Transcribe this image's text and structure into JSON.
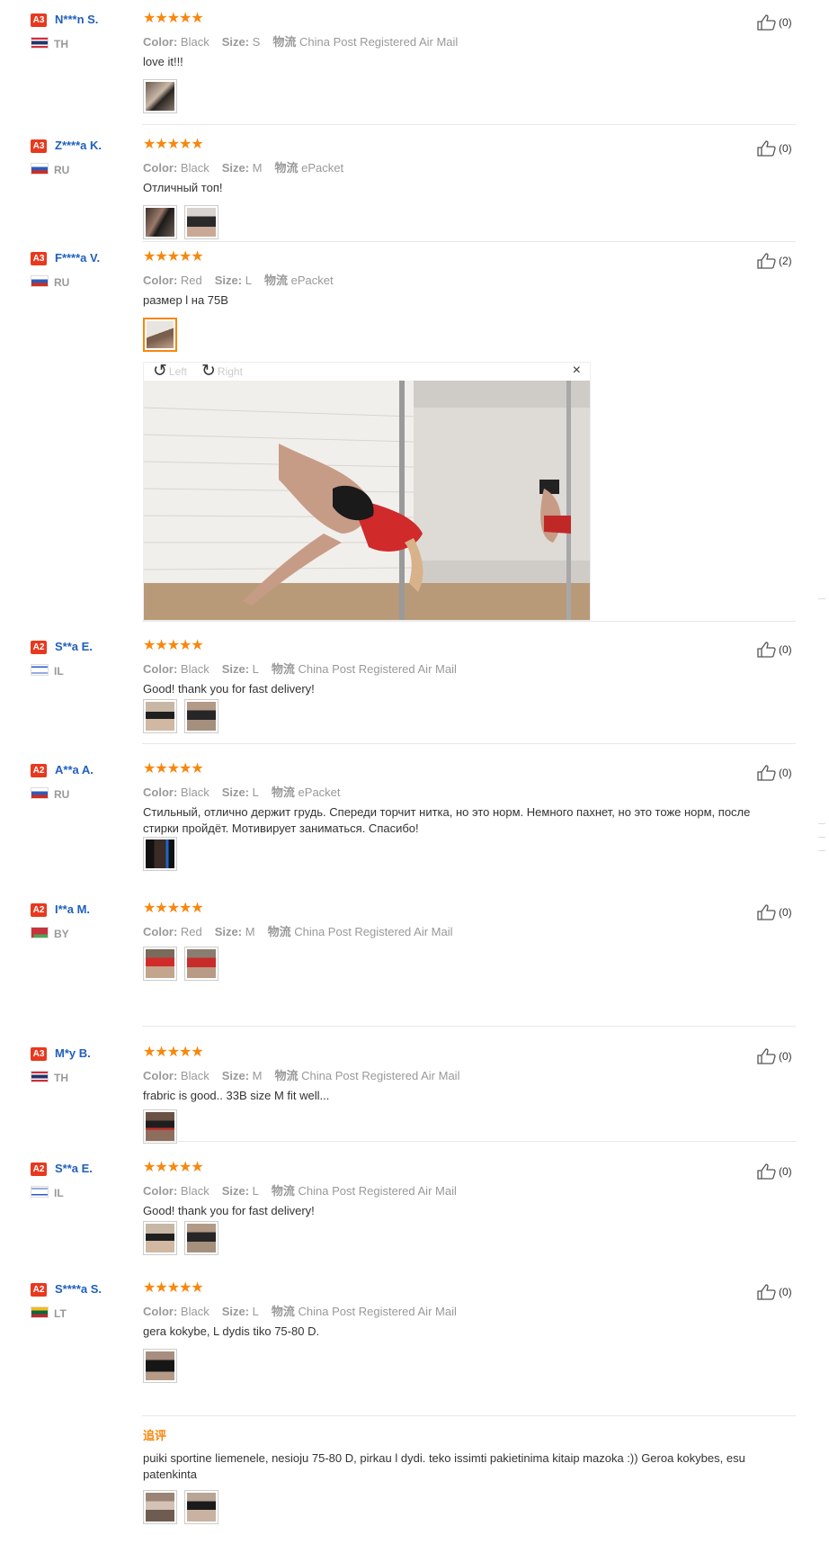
{
  "colors": {
    "accent": "#f7870d",
    "name": "#1f5fbf",
    "badge": "#e8391f"
  },
  "labels": {
    "color": "Color:",
    "size": "Size:",
    "shipping": "物流"
  },
  "reviews": [
    {
      "badge": "A3",
      "name": "N***n S.",
      "country": "TH",
      "stars": "★★★★★",
      "rating": 5,
      "color": "Black",
      "size": "S",
      "ship": "China Post Registered Air Mail",
      "text": "love it!!!",
      "likes": "(0)"
    },
    {
      "badge": "A3",
      "name": "Z****a K.",
      "country": "RU",
      "stars": "★★★★★",
      "rating": 5,
      "color": "Black",
      "size": "M",
      "ship": "ePacket",
      "text": "Отличный топ!",
      "likes": "(0)"
    },
    {
      "badge": "A3",
      "name": "F****a V.",
      "country": "RU",
      "stars": "★★★★★",
      "rating": 5,
      "color": "Red",
      "size": "L",
      "ship": "ePacket",
      "text": "размер l на 75В",
      "likes": "(2)"
    },
    {
      "badge": "A2",
      "name": "S**a E.",
      "country": "IL",
      "stars": "★★★★★",
      "rating": 5,
      "color": "Black",
      "size": "L",
      "ship": "China Post Registered Air Mail",
      "text": "Good! thank you for fast delivery!",
      "likes": "(0)"
    },
    {
      "badge": "A2",
      "name": "A**a A.",
      "country": "RU",
      "stars": "★★★★★",
      "rating": 5,
      "color": "Black",
      "size": "L",
      "ship": "ePacket",
      "text": "Стильный, отлично держит грудь. Спереди торчит нитка, но это норм. Немного пахнет, но это тоже норм, после стирки пройдёт. Мотивирует заниматься. Спасибо!",
      "likes": "(0)"
    },
    {
      "badge": "A2",
      "name": "I**a M.",
      "country": "BY",
      "stars": "★★★★★",
      "rating": 5,
      "color": "Red",
      "size": "M",
      "ship": "China Post Registered Air Mail",
      "text": "",
      "likes": "(0)"
    },
    {
      "badge": "A3",
      "name": "M*y B.",
      "country": "TH",
      "stars": "★★★★★",
      "rating": 5,
      "color": "Black",
      "size": "M",
      "ship": "China Post Registered Air Mail",
      "text": "frabric is good.. 33B size M fit well...",
      "likes": "(0)"
    },
    {
      "badge": "A2",
      "name": "S**a E.",
      "country": "IL",
      "stars": "★★★★★",
      "rating": 5,
      "color": "Black",
      "size": "L",
      "ship": "China Post Registered Air Mail",
      "text": "Good! thank you for fast delivery!",
      "likes": "(0)"
    },
    {
      "badge": "A2",
      "name": "S****a S.",
      "country": "LT",
      "stars": "★★★★★",
      "rating": 5,
      "color": "Black",
      "size": "L",
      "ship": "China Post Registered Air Mail",
      "text": "gera kokybe, L dydis tiko 75-80 D.",
      "likes": "(0)"
    }
  ],
  "viewer": {
    "rotate_left": "Left",
    "rotate_right": "Right",
    "close": "×"
  },
  "additional": {
    "label": "追评",
    "text": "puiki sportine liemenele, nesioju 75-80 D, pirkau l dydi. teko issimti pakietinima kitaip mazoka :)) Geroa kokybes, esu patenkinta"
  }
}
